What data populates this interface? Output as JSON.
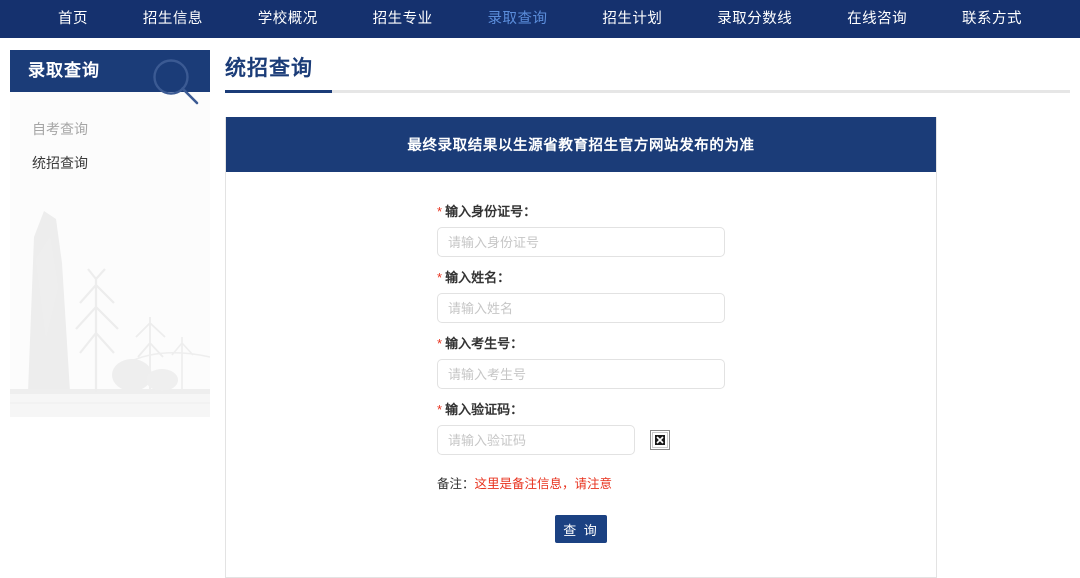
{
  "nav": {
    "items": [
      {
        "label": "首页",
        "active": false
      },
      {
        "label": "招生信息",
        "active": false
      },
      {
        "label": "学校概况",
        "active": false
      },
      {
        "label": "招生专业",
        "active": false
      },
      {
        "label": "录取查询",
        "active": true
      },
      {
        "label": "招生计划",
        "active": false
      },
      {
        "label": "录取分数线",
        "active": false
      },
      {
        "label": "在线咨询",
        "active": false
      },
      {
        "label": "联系方式",
        "active": false
      }
    ],
    "bg_color": "#15316e",
    "active_color": "#5b8ddb"
  },
  "sidebar": {
    "header_title": "录取查询",
    "header_icon": "search-icon",
    "items": [
      {
        "label": "自考查询",
        "state": "muted"
      },
      {
        "label": "统招查询",
        "state": "current"
      }
    ],
    "watermark_icon": "stone-monument-watermark"
  },
  "main": {
    "page_title": "统招查询",
    "title_accent_color": "#1b3c78"
  },
  "form": {
    "banner": "最终录取结果以生源省教育招生官方网站发布的为准",
    "required_mark": "*",
    "fields": [
      {
        "label": "输入身份证号：",
        "placeholder": "请输入身份证号",
        "name": "id-number"
      },
      {
        "label": "输入姓名：",
        "placeholder": "请输入姓名",
        "name": "full-name"
      },
      {
        "label": "输入考生号：",
        "placeholder": "请输入考生号",
        "name": "exam-number"
      },
      {
        "label": "输入验证码：",
        "placeholder": "请输入验证码",
        "name": "captcha"
      }
    ],
    "captcha_image_icon": "broken-image-icon",
    "note_label": "备注：",
    "note_text": "这里是备注信息，请注意",
    "note_color": "#e8321e",
    "submit_label": "查 询",
    "submit_color": "#1b4182"
  }
}
